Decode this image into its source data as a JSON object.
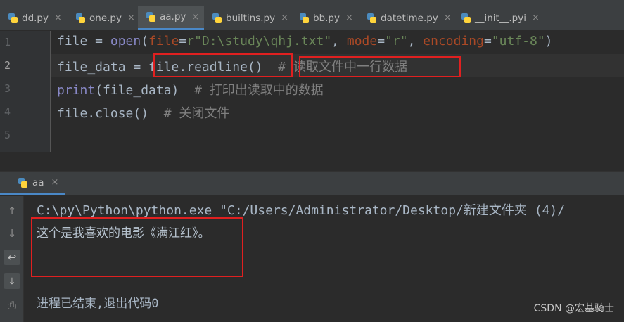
{
  "tabs": [
    {
      "label": "dd.py",
      "active": false
    },
    {
      "label": "one.py",
      "active": false
    },
    {
      "label": "aa.py",
      "active": true
    },
    {
      "label": "builtins.py",
      "active": false
    },
    {
      "label": "bb.py",
      "active": false
    },
    {
      "label": "datetime.py",
      "active": false
    },
    {
      "label": "__init__.pyi",
      "active": false
    }
  ],
  "tab_close_glyph": "×",
  "editor": {
    "line_numbers": [
      "1",
      "2",
      "3",
      "4",
      "5"
    ],
    "current_line": 2,
    "lines": [
      {
        "file_kw": "file = ",
        "open_fn": "open",
        "paren_open": "(",
        "p_file": "file",
        "eq1": "=",
        "str_path": "r\"D:\\study\\qhj.txt\"",
        "comma1": ", ",
        "p_mode": "mode",
        "eq2": "=",
        "str_mode": "\"r\"",
        "comma2": ", ",
        "p_enc": "encoding",
        "eq3": "=",
        "str_enc": "\"utf-8\"",
        "paren_close": ")"
      },
      {
        "code": "file_data = ",
        "call": "file.readline()",
        "comment": "# 读取文件中一行数据"
      },
      {
        "fn": "print",
        "code": "(file_data)",
        "comment": "# 打印出读取中的数据"
      },
      {
        "code": "file.close()",
        "comment": "# 关闭文件"
      },
      {
        "code": ""
      }
    ]
  },
  "run": {
    "tab_label": "aa",
    "command_line": "C:\\py\\Python\\python.exe \"C:/Users/Administrator/Desktop/新建文件夹 (4)/",
    "output_line": "这个是我喜欢的电影《满江红》。",
    "exit_message": "进程已结束,退出代码0",
    "toolbar": [
      {
        "name": "up-arrow-icon",
        "glyph": "↑"
      },
      {
        "name": "down-arrow-icon",
        "glyph": "↓"
      },
      {
        "name": "soft-wrap-icon",
        "glyph": "↩"
      },
      {
        "name": "scroll-to-end-icon",
        "glyph": "⤓"
      },
      {
        "name": "print-icon",
        "glyph": "⎙"
      }
    ]
  },
  "watermark": "CSDN @宏基骑士",
  "colors": {
    "keyword": "#8888c6",
    "param": "#aa4926",
    "string": "#6a8759",
    "comment": "#808080",
    "highlight_box": "#e02020",
    "tab_active_underline": "#4a88c7"
  }
}
